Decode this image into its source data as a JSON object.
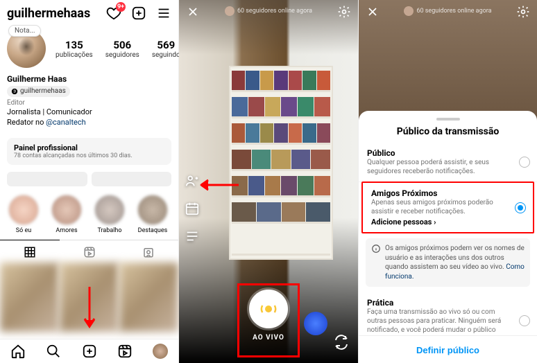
{
  "panel1": {
    "username": "guilhermehaas",
    "badge_count": "9+",
    "note_label": "Nota...",
    "stats": {
      "posts_num": "135",
      "posts_lbl": "publicações",
      "followers_num": "506",
      "followers_lbl": "seguidores",
      "following_num": "569",
      "following_lbl": "seguindo"
    },
    "bio": {
      "name": "Guilherme Haas",
      "threads_handle": "guilhermehaas",
      "category": "Editor",
      "line1": "Jornalista | Comunicador",
      "line2_prefix": "Redator no ",
      "line2_link": "@canaltech"
    },
    "pro": {
      "title": "Painel profissional",
      "subtitle": "78 contas alcançadas nos últimos 30 dias."
    },
    "highlights": [
      {
        "label": "Só eu"
      },
      {
        "label": "Amores"
      },
      {
        "label": "Trabalho"
      },
      {
        "label": "Destaques"
      }
    ]
  },
  "panel2": {
    "online_status": "60 seguidores online agora",
    "live_label": "AO VIVO"
  },
  "panel3": {
    "online_status": "60 seguidores online agora",
    "sheet_title": "Público da transmissão",
    "opt_public": {
      "title": "Público",
      "desc": "Qualquer pessoa poderá assistir, e seus seguidores receberão notificações."
    },
    "opt_close": {
      "title": "Amigos Próximos",
      "desc": "Apenas seus amigos próximos poderão assistir e receber notificações.",
      "add": "Adicione pessoas"
    },
    "info_text": "Os amigos próximos podem ver os nomes de usuário e as interações uns dos outros quando assistem ao seu vídeo ao vivo. ",
    "info_link": "Como funciona.",
    "opt_practice": {
      "title": "Prática",
      "desc": "Faça uma transmissão ao vivo só ou com outras pessoas para praticar. Ninguém será notificado, e você poderá mudar o público quando tudo estiver pronto."
    },
    "define_btn": "Definir público"
  }
}
